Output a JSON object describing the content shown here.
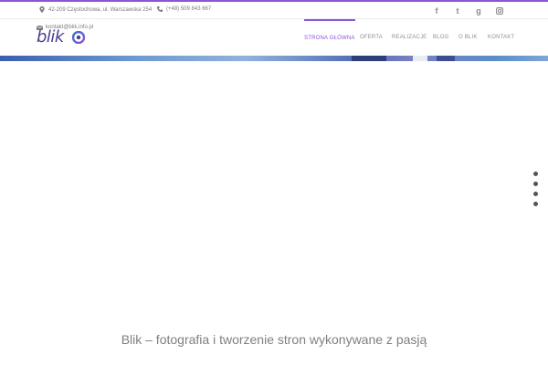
{
  "topbar": {
    "address": "42-209 Częstochowa, ul. Warszawska 254",
    "phone": "(+48) 509 843 667",
    "email": "kontakt@blik.info.pl",
    "social": [
      {
        "icon": "facebook-icon",
        "glyph": "f"
      },
      {
        "icon": "tumblr-icon",
        "glyph": "t"
      },
      {
        "icon": "google-plus-icon",
        "glyph": "g"
      },
      {
        "icon": "instagram-icon",
        "glyph": ""
      }
    ]
  },
  "logo": {
    "text": "blik"
  },
  "nav": {
    "items": [
      {
        "label": "STRONA GŁÓWNA",
        "active": true
      },
      {
        "label": "OFERTA",
        "active": false
      },
      {
        "label": "REALIZACJE",
        "active": false
      },
      {
        "label": "BLOG",
        "active": false
      },
      {
        "label": "O BLIK",
        "active": false
      },
      {
        "label": "KONTAKT",
        "active": false
      }
    ]
  },
  "hero": {
    "tagline": "Blik – fotografia i tworzenie stron wykonywane z pasją"
  },
  "colors": {
    "accent": "#8c55d4",
    "logo": "#4a3f8f",
    "text": "#7d7d7d"
  }
}
